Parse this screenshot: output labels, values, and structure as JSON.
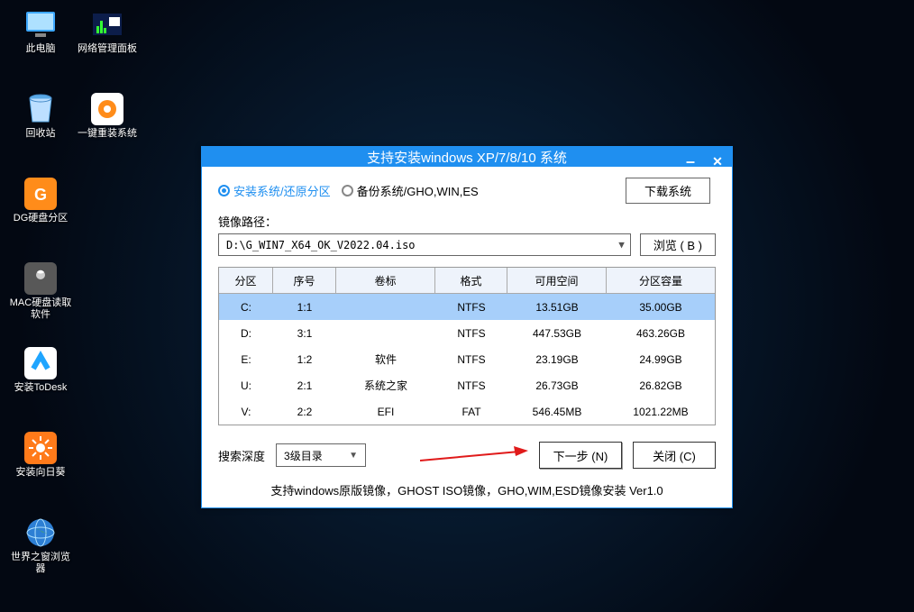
{
  "desktop": [
    {
      "id": "thispc",
      "label": "此电脑",
      "icon": "monitor"
    },
    {
      "id": "netpanel",
      "label": "网络管理面板",
      "icon": "chart"
    },
    {
      "id": "recycle",
      "label": "回收站",
      "icon": "bin"
    },
    {
      "id": "reinstall",
      "label": "一键重装系统",
      "icon": "gear-orange"
    },
    {
      "id": "diskgenius",
      "label": "DG硬盘分区",
      "icon": "dg"
    },
    {
      "id": "",
      "label": "",
      "icon": ""
    },
    {
      "id": "macdisk",
      "label": "MAC硬盘读取软件",
      "icon": "mac"
    },
    {
      "id": "",
      "label": "",
      "icon": ""
    },
    {
      "id": "todesk",
      "label": "安装ToDesk",
      "icon": "todesk"
    },
    {
      "id": "",
      "label": "",
      "icon": ""
    },
    {
      "id": "sunflower",
      "label": "安装向日葵",
      "icon": "sunflower"
    },
    {
      "id": "",
      "label": "",
      "icon": ""
    },
    {
      "id": "browser",
      "label": "世界之窗浏览器",
      "icon": "globe"
    }
  ],
  "window": {
    "title": "支持安装windows XP/7/8/10 系统",
    "radios": {
      "install": "安装系统/还原分区",
      "backup": "备份系统/GHO,WIN,ES"
    },
    "download_btn": "下载系统",
    "path_label": "镜像路径：",
    "path_value": "D:\\G_WIN7_X64_OK_V2022.04.iso",
    "browse_btn": "浏览 ( B )",
    "headers": {
      "drive": "分区",
      "index": "序号",
      "volume": "卷标",
      "format": "格式",
      "free": "可用空间",
      "capacity": "分区容量"
    },
    "rows": [
      {
        "drive": "C:",
        "index": "1:1",
        "volume": "",
        "format": "NTFS",
        "free": "13.51GB",
        "capacity": "35.00GB",
        "selected": true
      },
      {
        "drive": "D:",
        "index": "3:1",
        "volume": "",
        "format": "NTFS",
        "free": "447.53GB",
        "capacity": "463.26GB"
      },
      {
        "drive": "E:",
        "index": "1:2",
        "volume": "软件",
        "format": "NTFS",
        "free": "23.19GB",
        "capacity": "24.99GB"
      },
      {
        "drive": "U:",
        "index": "2:1",
        "volume": "系统之家",
        "format": "NTFS",
        "free": "26.73GB",
        "capacity": "26.82GB"
      },
      {
        "drive": "V:",
        "index": "2:2",
        "volume": "EFI",
        "format": "FAT",
        "free": "546.45MB",
        "capacity": "1021.22MB"
      }
    ],
    "depth_label": "搜索深度",
    "depth_value": "3级目录",
    "next_btn": "下一步 (N)",
    "close_btn": "关闭 (C)",
    "footer": "支持windows原版镜像，GHOST ISO镜像，GHO,WIM,ESD镜像安装 Ver1.0"
  }
}
